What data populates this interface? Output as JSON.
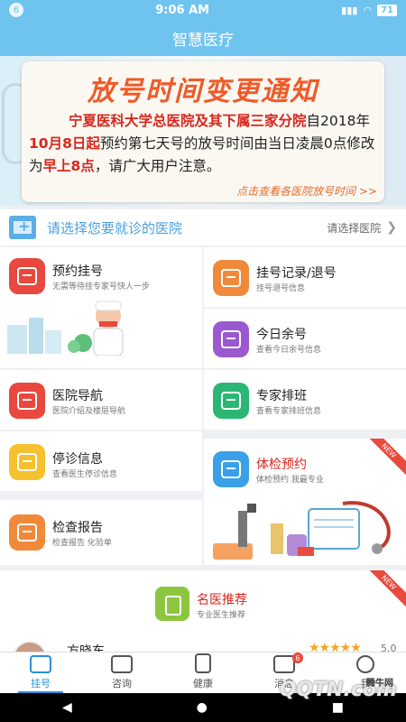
{
  "status": {
    "icon_text": "6",
    "time": "9:06 AM",
    "battery": "71"
  },
  "app": {
    "title": "智慧医疗"
  },
  "banner": {
    "title": "放号时间变更通知",
    "body_red1": "宁夏医科大学总医院及其下属三家分院",
    "body_1": "自2018年",
    "body_red2": "10月8日起",
    "body_2": "预约第七天号的放号时间由当日凌晨0点修改为",
    "body_red3": "早上8点",
    "body_3": "，请广大用户注意。",
    "link": "点击查看各医院放号时间 >>"
  },
  "hospital": {
    "prompt": "请选择您要就诊的医院",
    "select": "请选择医院"
  },
  "tiles": {
    "appointment": {
      "title": "预约挂号",
      "sub": "无需等待挂专家号快人一步",
      "color": "#e9483e"
    },
    "records": {
      "title": "挂号记录/退号",
      "sub": "挂号退号信息",
      "color": "#f08a3a"
    },
    "remaining": {
      "title": "今日余号",
      "sub": "查看今日余号信息",
      "color": "#9b59d0"
    },
    "navigation": {
      "title": "医院导航",
      "sub": "医院介绍及楼层导航",
      "color": "#e9483e"
    },
    "schedule": {
      "title": "专家排班",
      "sub": "查看专家排班信息",
      "color": "#2bb673"
    },
    "suspension": {
      "title": "停诊信息",
      "sub": "查看医生停诊信息",
      "color": "#f5c12e"
    },
    "checkup": {
      "title": "体检预约",
      "sub": "体检预约 我最专业",
      "color": "#3aa0e8",
      "new": "NEW"
    },
    "report": {
      "title": "检查报告",
      "sub": "检查报告 化验单",
      "color": "#f08a3a"
    }
  },
  "famous": {
    "title": "名医推荐",
    "sub": "专业医生推荐",
    "new": "NEW"
  },
  "doctor": {
    "name": "方晓东",
    "stars": "★★★★★",
    "rating": "5.0"
  },
  "tabs": [
    {
      "label": "挂号"
    },
    {
      "label": "咨询"
    },
    {
      "label": "健康"
    },
    {
      "label": "消息",
      "badge": "6"
    },
    {
      "label": "我"
    }
  ],
  "nav": {
    "back": "◀",
    "home": "●",
    "recent": "■"
  },
  "watermark": {
    "text": "QQTN.com",
    "sub": "腾牛网"
  }
}
